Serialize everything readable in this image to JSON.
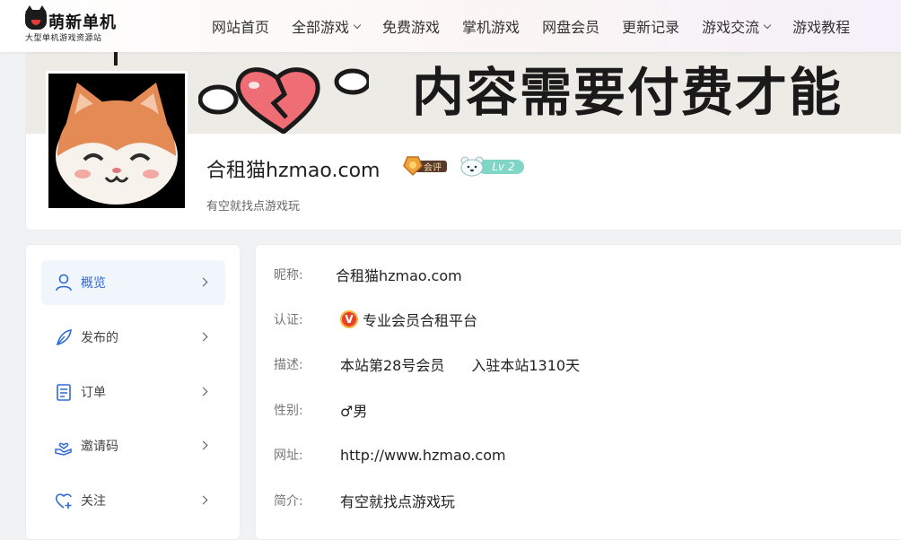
{
  "header": {
    "logo": {
      "title": "萌新单机",
      "subtitle": "大型单机游戏资源站"
    },
    "nav": [
      {
        "label": "网站首页",
        "dropdown": false
      },
      {
        "label": "全部游戏",
        "dropdown": true
      },
      {
        "label": "免费游戏",
        "dropdown": false
      },
      {
        "label": "掌机游戏",
        "dropdown": false
      },
      {
        "label": "网盘会员",
        "dropdown": false
      },
      {
        "label": "更新记录",
        "dropdown": false
      },
      {
        "label": "游戏交流",
        "dropdown": true
      },
      {
        "label": "游戏教程",
        "dropdown": false
      }
    ]
  },
  "profile": {
    "banner_text": "内容需要付费才能",
    "name": "合租猫hzmao.com",
    "medal_text": "会评",
    "level": "Lv 2",
    "motto": "有空就找点游戏玩"
  },
  "sidebar": {
    "items": [
      {
        "label": "概览",
        "icon": "user-icon",
        "active": true
      },
      {
        "label": "发布的",
        "icon": "feather-icon",
        "active": false
      },
      {
        "label": "订单",
        "icon": "document-icon",
        "active": false
      },
      {
        "label": "邀请码",
        "icon": "hand-heart-icon",
        "active": false
      },
      {
        "label": "关注",
        "icon": "heart-plus-icon",
        "active": false
      }
    ]
  },
  "info": {
    "nickname": {
      "label": "昵称:",
      "value": "合租猫hzmao.com"
    },
    "certification": {
      "label": "认证:",
      "badge": "V",
      "value": "专业会员合租平台"
    },
    "description": {
      "label": "描述:",
      "value": "本站第28号会员",
      "extra": "入驻本站1310天"
    },
    "gender": {
      "label": "性别:",
      "value": "♂男"
    },
    "website": {
      "label": "网址:",
      "value": "http://www.hzmao.com"
    },
    "bio": {
      "label": "简介:",
      "value": "有空就找点游戏玩"
    }
  },
  "colors": {
    "accent": "#2f6ad6",
    "level_pill": "#7fd6c7",
    "verify_badge": "#e8402d"
  }
}
